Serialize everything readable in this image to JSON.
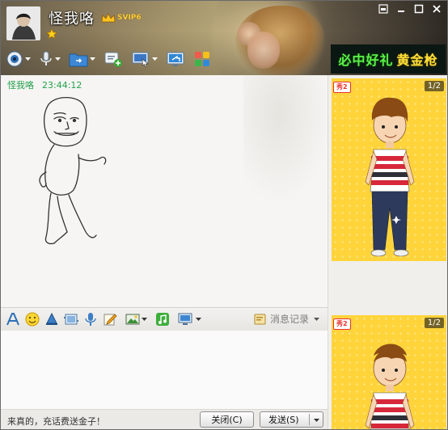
{
  "window": {
    "nickname": "怪我咯",
    "vip_badge": "SVIP6",
    "controls": {
      "skin_icon": "skin-icon",
      "minimize_icon": "minimize-icon",
      "maximize_icon": "maximize-icon",
      "close_icon": "close-icon"
    }
  },
  "toolbar": {
    "items": [
      "video-call-icon",
      "voice-call-icon",
      "file-transfer-icon",
      "message-plus-icon",
      "remote-assist-icon",
      "screen-share-icon",
      "apps-icon"
    ]
  },
  "banner": {
    "text_green": "必中好礼",
    "text_yellow": "黄金枪",
    "colors": {
      "green": "#5cf04a",
      "yellow": "#ffe03a"
    }
  },
  "message": {
    "sender": "怪我咯",
    "time": "23:44:12",
    "sender_color": "#22a04b"
  },
  "input_toolbar": {
    "items": [
      "font-icon",
      "emoji-icon",
      "shake-icon",
      "screenshot-frame-icon",
      "voice-message-icon",
      "doodle-icon",
      "image-icon",
      "music-icon",
      "screen-capture-icon"
    ],
    "history_label": "消息记录"
  },
  "bottom_bar": {
    "ad_text": "来真的，充话费送金子！",
    "close_label": "关闭(C)",
    "send_label": "发送(S)"
  },
  "show_panel": {
    "badge": "秀2",
    "page_top": "1/2",
    "page_bottom": "1/2",
    "background": "#ffd43b"
  }
}
